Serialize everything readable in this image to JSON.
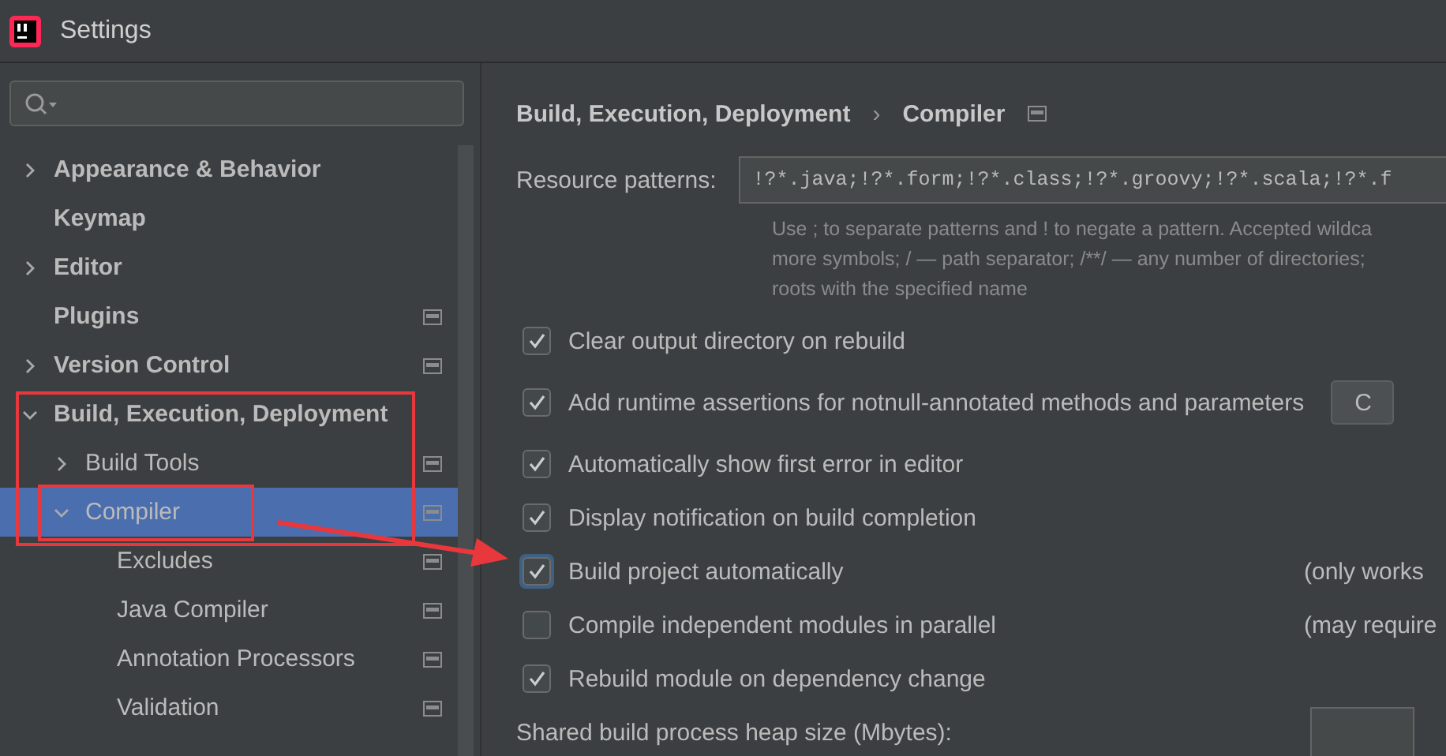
{
  "window": {
    "title": "Settings"
  },
  "sidebar": {
    "items": [
      {
        "label": "Appearance & Behavior",
        "expanded": false,
        "selected": false,
        "project_scoped": false
      },
      {
        "label": "Keymap",
        "selected": false,
        "project_scoped": false
      },
      {
        "label": "Editor",
        "expanded": false,
        "selected": false,
        "project_scoped": false
      },
      {
        "label": "Plugins",
        "selected": false,
        "project_scoped": true
      },
      {
        "label": "Version Control",
        "expanded": false,
        "selected": false,
        "project_scoped": true
      },
      {
        "label": "Build, Execution, Deployment",
        "expanded": true,
        "selected": false,
        "project_scoped": false,
        "children": [
          {
            "label": "Build Tools",
            "expanded": false,
            "selected": false,
            "project_scoped": true
          },
          {
            "label": "Compiler",
            "expanded": true,
            "selected": true,
            "project_scoped": true,
            "children": [
              {
                "label": "Excludes",
                "selected": false,
                "project_scoped": true
              },
              {
                "label": "Java Compiler",
                "selected": false,
                "project_scoped": true
              },
              {
                "label": "Annotation Processors",
                "selected": false,
                "project_scoped": true
              },
              {
                "label": "Validation",
                "selected": false,
                "project_scoped": true
              }
            ]
          }
        ]
      }
    ]
  },
  "breadcrumb": {
    "parent": "Build, Execution, Deployment",
    "separator": "›",
    "current": "Compiler"
  },
  "resource_patterns": {
    "label": "Resource patterns:",
    "value": "!?*.java;!?*.form;!?*.class;!?*.groovy;!?*.scala;!?*.f",
    "hint": [
      "Use ; to separate patterns and ! to negate a pattern. Accepted wildca",
      "more symbols; / — path separator; /**/ — any number of directories;",
      "roots with the specified name"
    ]
  },
  "options": [
    {
      "label": "Clear output directory on rebuild",
      "checked": true,
      "focused": false
    },
    {
      "label": "Add runtime assertions for notnull-annotated methods and parameters",
      "checked": true,
      "focused": false,
      "button": "C"
    },
    {
      "label": "Automatically show first error in editor",
      "checked": true,
      "focused": false
    },
    {
      "label": "Display notification on build completion",
      "checked": true,
      "focused": false
    },
    {
      "label": "Build project automatically",
      "checked": true,
      "focused": true,
      "note": "(only works"
    },
    {
      "label": "Compile independent modules in parallel",
      "checked": false,
      "focused": false,
      "note": "(may require"
    },
    {
      "label": "Rebuild module on dependency change",
      "checked": true,
      "focused": false
    }
  ],
  "heap_size": {
    "label": "Shared build process heap size (Mbytes):"
  }
}
